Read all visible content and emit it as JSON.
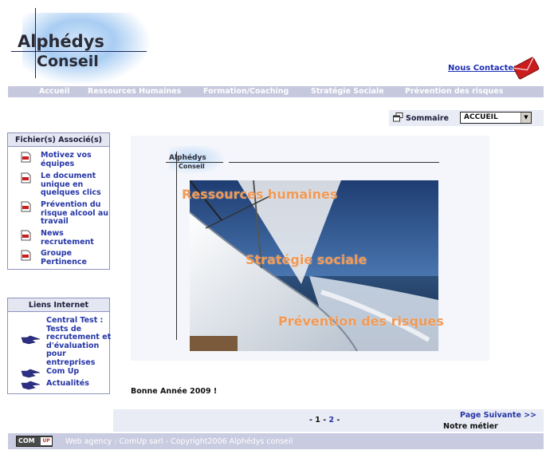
{
  "header": {
    "logo_line1": "Alphédys",
    "logo_line2": "Conseil",
    "contact_label": "Nous Contacter",
    "contact_icon": "mail-envelope-icon"
  },
  "nav": {
    "items": [
      {
        "label": "Accueil"
      },
      {
        "label": "Ressources Humaines"
      },
      {
        "label": "Formation/Coaching"
      },
      {
        "label": "Stratégie Sociale"
      },
      {
        "label": "Prévention des risques"
      }
    ]
  },
  "sommaire": {
    "icon": "windows-icon",
    "label": "Sommaire",
    "selected": "ACCUEIL"
  },
  "files_box": {
    "title": "Fichier(s) Associé(s)",
    "icon": "pdf-icon",
    "items": [
      {
        "label": "Motivez vos équipes"
      },
      {
        "label": "Le document unique en quelques clics"
      },
      {
        "label": "Prévention du risque alcool au travail"
      },
      {
        "label": "News recrutement"
      },
      {
        "label": "Groupe Pertinence"
      }
    ]
  },
  "links_box": {
    "title": "Liens Internet",
    "icon": "pointing-hand-icon",
    "items": [
      {
        "label": "Central Test : Tests de recrutement et d'évaluation pour entreprises"
      },
      {
        "label": "Com Up"
      },
      {
        "label": "Actualités"
      }
    ]
  },
  "main": {
    "inner_logo_line1": "Alphédys",
    "inner_logo_line2": "Conseil",
    "overlay_1": "Ressources humaines",
    "overlay_2": "Stratégie sociale",
    "overlay_3": "Prévention des risques",
    "greeting": "Bonne Année 2009 !"
  },
  "pager": {
    "prefix": "-",
    "page1": "1",
    "sep": "-",
    "page2": "2",
    "suffix": "-",
    "next_label": "Page Suivante >>",
    "section_label": "Notre métier"
  },
  "footer": {
    "logo_left": "COM",
    "logo_right": "UP",
    "text": "Web agency : ComUp sarl - Copyright2006 Alphédys conseil"
  }
}
